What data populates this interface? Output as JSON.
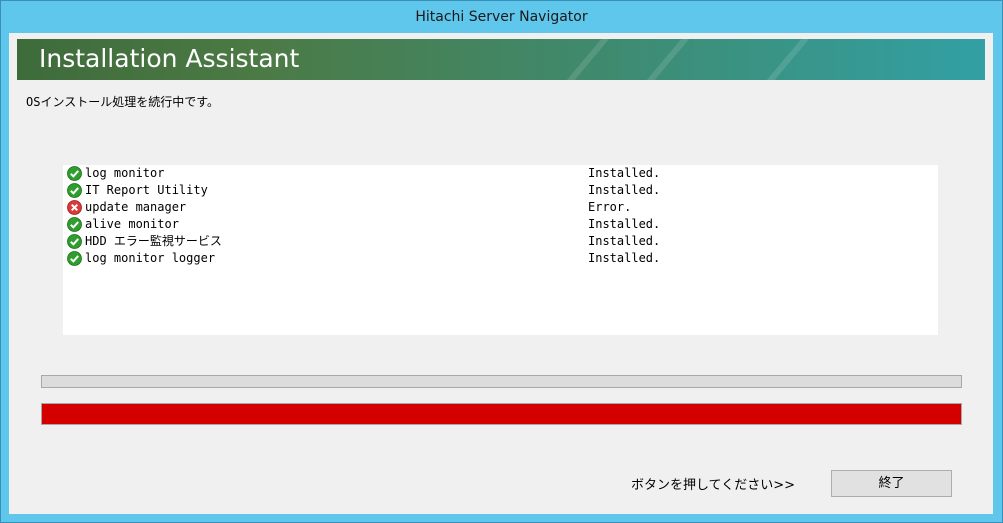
{
  "window": {
    "title": "Hitachi Server Navigator"
  },
  "banner": {
    "title": "Installation Assistant"
  },
  "status_message": "OSインストール処理を続行中です。",
  "components": [
    {
      "name": "log monitor",
      "status": "Installed.",
      "icon": "check-icon"
    },
    {
      "name": "IT Report Utility",
      "status": "Installed.",
      "icon": "check-icon"
    },
    {
      "name": "update manager",
      "status": "Error.",
      "icon": "error-icon"
    },
    {
      "name": "alive monitor",
      "status": "Installed.",
      "icon": "check-icon"
    },
    {
      "name": "HDD エラー監視サービス",
      "status": "Installed.",
      "icon": "check-icon"
    },
    {
      "name": "log monitor logger",
      "status": "Installed.",
      "icon": "check-icon"
    }
  ],
  "progress": {
    "overall_fraction": 0,
    "error_fraction": 1.0,
    "error_color": "#d40000"
  },
  "footer": {
    "prompt": "ボタンを押してください>>",
    "finish_label": "終了"
  },
  "colors": {
    "title_bar": "#5fc6ec",
    "success": "#2e9e2e",
    "error": "#d93a3a"
  }
}
